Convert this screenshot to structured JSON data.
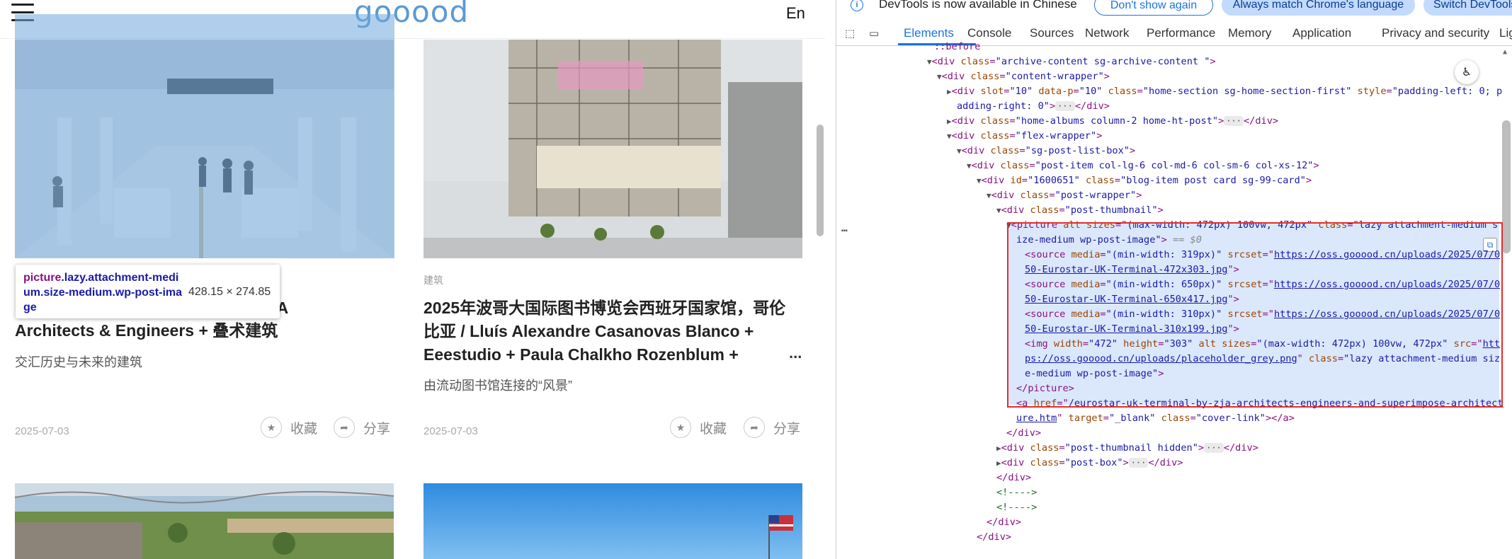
{
  "site": {
    "logo": "gooood",
    "lang": "En",
    "cards": [
      {
        "title": "/ ZJA Architects & Engineers + 叠术建筑",
        "title_line1": "/ ZJA",
        "title_line2": "Architects & Engineers + 叠术建筑",
        "subtitle": "交汇历史与未来的建筑",
        "date": "2025-07-03",
        "fav": "收藏",
        "share": "分享"
      },
      {
        "tag": "建筑",
        "title_line1": "2025年波哥大国际图书博览会西班牙国家馆，哥伦",
        "title_line2": "比亚 / Lluís Alexandre Casanovas Blanco +",
        "title_line3": "Eeestudio + Paula Chalkho Rozenblum +",
        "ellipsis": "...",
        "subtitle": "由流动图书馆连接的“风景”",
        "date": "2025-07-03",
        "fav": "收藏",
        "share": "分享"
      }
    ],
    "tooltip": {
      "tag": "picture",
      "classes": ".lazy.attachment-medium.size-medium.wp-post-image",
      "size": "428.15 × 274.85"
    }
  },
  "devtools": {
    "infobar": {
      "message": "DevTools is now available in Chinese",
      "btn_dont_show": "Don't show again",
      "btn_match": "Always match Chrome's language",
      "btn_switch": "Switch DevTools to Chinese"
    },
    "tabs": [
      "Elements",
      "Console",
      "Sources",
      "Network",
      "Performance",
      "Memory",
      "Application",
      "Privacy and security",
      "Lighthouse"
    ],
    "active_tab": "Elements",
    "lines": {
      "l0": "::before",
      "l1_tag": "div",
      "l1_attr": "class",
      "l1_val": "\"archive-content sg-archive-content \"",
      "l2_val": "\"content-wrapper\"",
      "l3a": "slot",
      "l3a_v": "\"10\"",
      "l3b": "data-p",
      "l3b_v": "\"10\"",
      "l3c_v": "\"home-section sg-home-section-first\"",
      "l3d": "style",
      "l3d_v": "\"padding-left: 0; p",
      "l3e": "adding-right: 0\"",
      "l4_val": "\"home-albums column-2 home-ht-post\"",
      "l5_val": "\"flex-wrapper\"",
      "l6_val": "\"sg-post-list-box\"",
      "l7_val": "\"post-item col-lg-6 col-md-6 col-sm-6 col-xs-12\"",
      "l8_id": "\"1600651\"",
      "l8_val": "\"blog-item post card sg-99-card\"",
      "l9_val": "\"post-wrapper\"",
      "l10_val": "\"post-thumbnail\"",
      "p1": "picture",
      "p1_alt": "alt",
      "p1_sizes": "sizes",
      "p1_sizes_v": "\"(max-width: 472px) 100vw, 472px\"",
      "p1_class_v": "\"lazy attachment-medium s",
      "p2": "ize-medium wp-post-image\"",
      "p2_eq": "== $0",
      "s1_media": "\"(min-width: 319px)\"",
      "s1_srcset": "https://oss.gooood.cn/uploads/2025/07/0",
      "s1_b": "50-Eurostar-UK-Terminal-472x303.jpg",
      "s2_media": "\"(min-width: 650px)\"",
      "s2_srcset": "https://oss.gooood.cn/uploads/2025/07/0",
      "s2_b": "50-Eurostar-UK-Terminal-650x417.jpg",
      "s3_media": "\"(min-width: 310px)\"",
      "s3_srcset": "https://oss.gooood.cn/uploads/2025/07/0",
      "s3_b": "50-Eurostar-UK-Terminal-310x199.jpg",
      "img_w": "\"472\"",
      "img_h": "\"303\"",
      "img_sizes": "\"(max-width: 472px) 100vw, 472px\"",
      "img_src": "htt",
      "img_src2": "ps://oss.gooood.cn/uploads/placeholder_grey.png",
      "img_class": "\"lazy attachment-medium siz",
      "img_class2": "e-medium wp-post-image\"",
      "close_picture": "</picture>",
      "a_href": "/eurostar-uk-terminal-by-zja-architects-engineers-and-superimpose-architect",
      "a_href2": "ure.htm",
      "a_target": "\"_blank\"",
      "a_class": "\"cover-link\"",
      "close_div": "</div>",
      "hidden_val": "\"post-thumbnail hidden\"",
      "box_val": "\"post-box\"",
      "comment": "<!---->"
    }
  }
}
